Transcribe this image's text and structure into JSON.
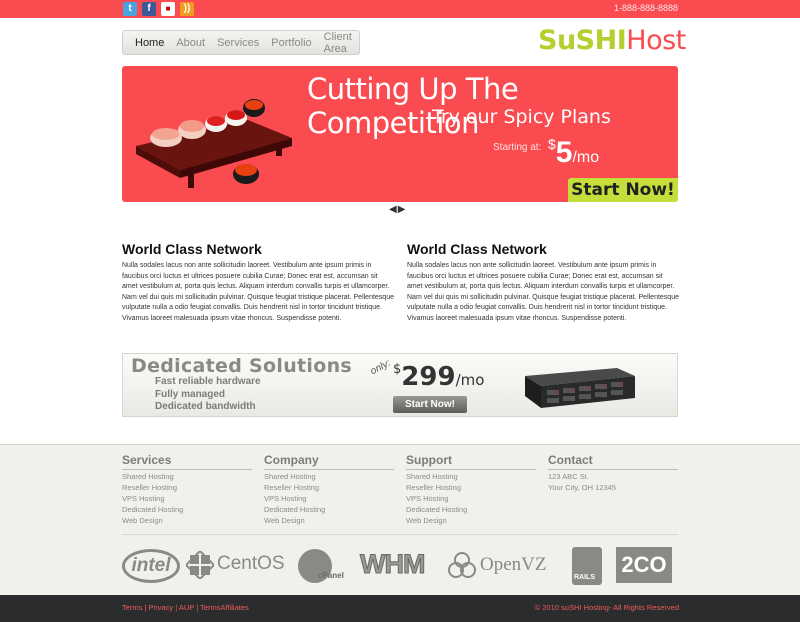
{
  "topbar": {
    "social_icons": [
      "twitter-icon",
      "facebook-icon",
      "delicious-icon",
      "rss-icon"
    ],
    "phone": "1-888-888-8888"
  },
  "nav": {
    "items": [
      "Home",
      "About",
      "Services",
      "Portfolio",
      "Client Area"
    ]
  },
  "logo": {
    "part1": "SuSHI",
    "part2": "Host"
  },
  "slider": {
    "headline": "Cutting Up The Competition",
    "subheadline": "Try our Spicy Plans",
    "starting_at": "Starting at:",
    "currency": "$",
    "price": "5",
    "per": "/mo",
    "cta": "Start Now!"
  },
  "columns": [
    {
      "title": "World Class Network",
      "body": "Nulla sodales lacus non ante sollicitudin laoreet. Vestibulum ante ipsum primis in faucibus orci luctus et ultrices posuere cubilia Curae; Donec erat est, accumsan sit amet vestibulum at, porta quis lectus. Aliquam interdum convallis turpis et ullamcorper. Nam vel dui quis mi sollicitudin pulvinar. Quisque feugiat tristique placerat. Pellentesque vulputate nulla a odio feugiat convallis. Duis hendrerit nisl in tortor tincidunt tristique. Vivamus laoreet malesuada ipsum vitae rhoncus. Suspendisse potenti."
    },
    {
      "title": "World Class Network",
      "body": "Nulla sodales lacus non ante sollicitudin laoreet. Vestibulum ante ipsum primis in faucibus orci luctus et ultrices posuere cubilia Curae; Donec erat est, accumsan sit amet vestibulum at, porta quis lectus. Aliquam interdum convallis turpis et ullamcorper. Nam vel dui quis mi sollicitudin pulvinar. Quisque feugiat tristique placerat. Pellentesque vulputate nulla a odio feugiat convallis. Duis hendrerit nisl in tortor tincidunt tristique. Vivamus laoreet malesuada ipsum vitae rhoncus. Suspendisse potenti."
    }
  ],
  "dedicated": {
    "title": "Dedicated Solutions",
    "features": [
      "Fast reliable hardware",
      "Fully managed",
      "Dedicated bandwidth"
    ],
    "only": "only:",
    "currency": "$",
    "price": "299",
    "per": "/mo",
    "cta": "Start Now!"
  },
  "footer": {
    "columns": [
      {
        "title": "Services",
        "links": [
          "Shared Hosting",
          "Reseller Hosting",
          "VPS Hosting",
          "Dedicated Hosting",
          "Web Design"
        ]
      },
      {
        "title": "Company",
        "links": [
          "Shared Hosting",
          "Reseller Hosting",
          "VPS Hosting",
          "Dedicated Hosting",
          "Web Design"
        ]
      },
      {
        "title": "Support",
        "links": [
          "Shared Hosting",
          "Reseller Hosting",
          "VPS Hosting",
          "Dedicated Hosting",
          "Web Design"
        ]
      },
      {
        "title": "Contact",
        "links": [
          "123 ABC St.",
          "Your City, OH 12345"
        ]
      }
    ],
    "partner_logos": [
      "intel",
      "CentOS",
      "cPanel",
      "WHM",
      "OpenVZ",
      "RAILS",
      "2CO"
    ],
    "bottom_links": [
      "Terms",
      "Privacy",
      "AUP",
      "TermsAffiliates"
    ],
    "copyright": "© 2010 suSHI Hosting- All Rights Reserved"
  },
  "colors": {
    "brand_red": "#fa4b50",
    "brand_green": "#b5cf2f",
    "dark": "#2b2c2e"
  }
}
